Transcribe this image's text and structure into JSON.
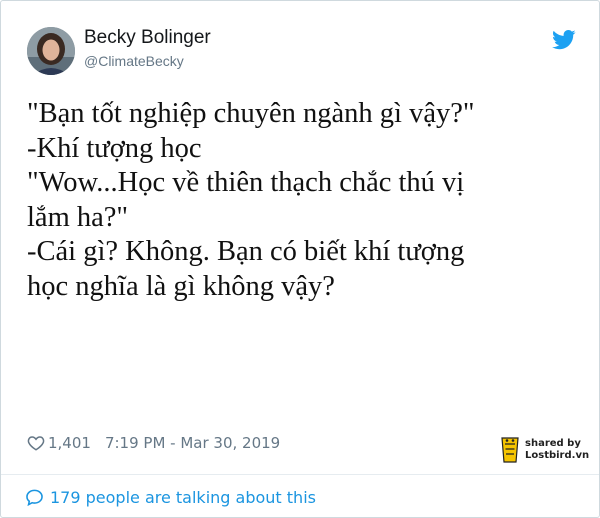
{
  "author": {
    "name": "Becky Bolinger",
    "handle": "@ClimateBecky"
  },
  "tweet": {
    "text": "\"Bạn tốt nghiệp chuyên ngành gì vậy?\"\n-Khí tượng học\n\"Wow...Học về thiên thạch chắc thú vị\nlắm ha?\"\n-Cái gì? Không. Bạn có biết khí tượng\nhọc nghĩa là gì không vậy?"
  },
  "meta": {
    "likes": "1,401",
    "timestamp": "7:19 PM - Mar 30, 2019"
  },
  "badge": {
    "line1": "shared by",
    "line2": "Lostbird.vn"
  },
  "footer": {
    "talking": "179 people are talking about this"
  },
  "icons": {
    "brand": "twitter-bird-icon",
    "like": "heart-icon",
    "reply": "speech-bubble-icon"
  },
  "colors": {
    "twitter_blue": "#1da1f2",
    "link_blue": "#1b95e0",
    "muted_gray": "#657786"
  }
}
